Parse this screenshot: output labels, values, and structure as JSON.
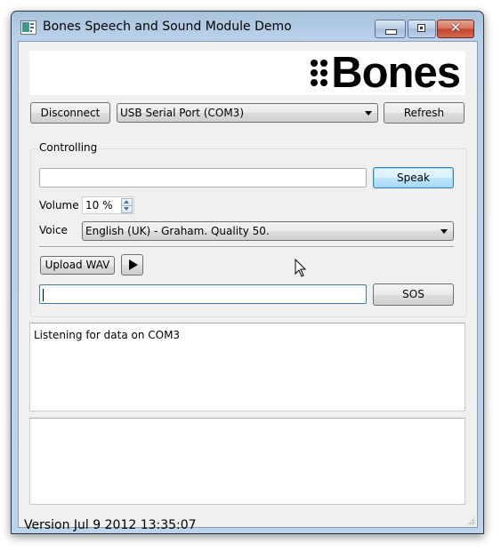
{
  "window": {
    "title": "Bones Speech and Sound Module Demo",
    "icon": "app-window-icon",
    "controls": {
      "minimize": "minimize-icon",
      "maximize": "restore-icon",
      "close_glyph": "✕"
    }
  },
  "logo": {
    "text": "Bones",
    "icon": "braille-dots-icon"
  },
  "connection": {
    "disconnect_label": "Disconnect",
    "port_selected": "USB Serial Port (COM3)",
    "refresh_label": "Refresh"
  },
  "controlling": {
    "group_label": "Controlling",
    "speak_text_value": "",
    "speak_label": "Speak",
    "volume_label": "Volume",
    "volume_value": "10 %",
    "voice_label": "Voice",
    "voice_selected": "English (UK) - Graham. Quality 50.",
    "upload_wav_label": "Upload WAV",
    "play_icon": "play-icon",
    "sos_text_value": "",
    "sos_label": "SOS"
  },
  "log": {
    "text": "Listening for data on COM3"
  },
  "output": {
    "text": ""
  },
  "status": {
    "version": "Version Jul  9 2012 13:35:07"
  }
}
